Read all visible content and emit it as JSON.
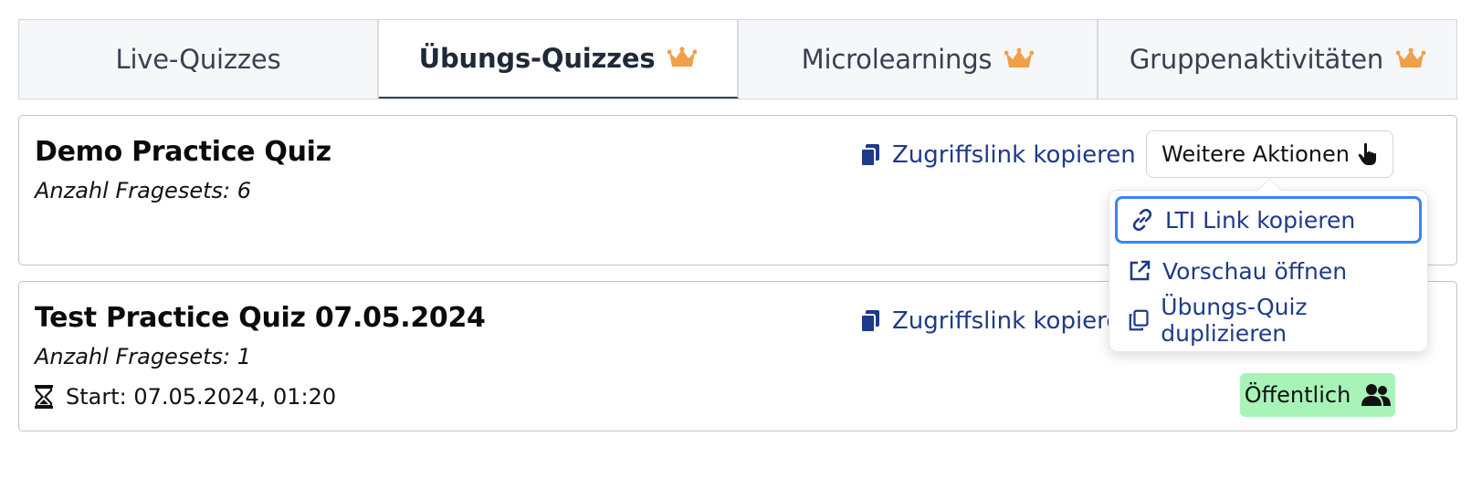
{
  "tabs": [
    {
      "label": "Live-Quizzes",
      "premium": false,
      "active": false
    },
    {
      "label": "Übungs-Quizzes",
      "premium": true,
      "active": true
    },
    {
      "label": "Microlearnings",
      "premium": true,
      "active": false
    },
    {
      "label": "Gruppenaktivitäten",
      "premium": true,
      "active": false
    }
  ],
  "quizzes": [
    {
      "title": "Demo Practice Quiz",
      "count": "Anzahl Fragesets: 6",
      "copy_label": "Zugriffslink kopieren",
      "more_label": "Weitere Aktionen"
    },
    {
      "title": "Test Practice Quiz 07.05.2024",
      "count": "Anzahl Fragesets: 1",
      "start": "Start: 07.05.2024, 01:20",
      "copy_label": "Zugriffslink kopieren",
      "status_badge": "Öffentlich"
    }
  ],
  "dropdown": {
    "items": [
      {
        "label": "LTI Link kopieren",
        "icon": "link-icon"
      },
      {
        "label": "Vorschau öffnen",
        "icon": "external-link-icon"
      },
      {
        "label": "Übungs-Quiz duplizieren",
        "icon": "copy-icon"
      }
    ]
  },
  "colors": {
    "link": "#1e3a8a",
    "crown": "#f0a04b",
    "badge_bg": "#a7f3b8",
    "focus_ring": "#3b82f6"
  }
}
